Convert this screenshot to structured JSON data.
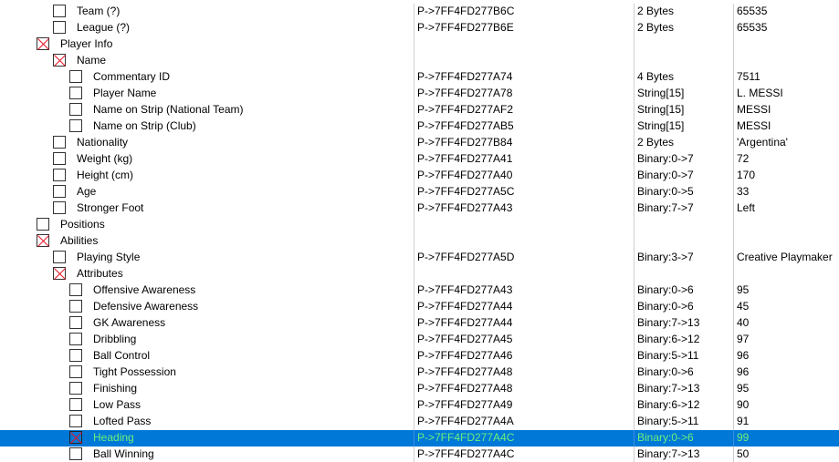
{
  "rows": [
    {
      "indent": 1,
      "checked": false,
      "desc": "Team (?)",
      "address": "P->7FF4FD277B6C",
      "type": "2 Bytes",
      "value": "65535"
    },
    {
      "indent": 1,
      "checked": false,
      "desc": "League (?)",
      "address": "P->7FF4FD277B6E",
      "type": "2 Bytes",
      "value": "65535"
    },
    {
      "indent": 0,
      "checked": true,
      "desc": "Player Info",
      "address": "",
      "type": "",
      "value": ""
    },
    {
      "indent": 1,
      "checked": true,
      "desc": "Name",
      "address": "",
      "type": "",
      "value": ""
    },
    {
      "indent": 2,
      "checked": false,
      "desc": "Commentary ID",
      "address": "P->7FF4FD277A74",
      "type": "4 Bytes",
      "value": "7511"
    },
    {
      "indent": 2,
      "checked": false,
      "desc": "Player Name",
      "address": "P->7FF4FD277A78",
      "type": "String[15]",
      "value": "L. MESSI"
    },
    {
      "indent": 2,
      "checked": false,
      "desc": "Name on Strip (National Team)",
      "address": "P->7FF4FD277AF2",
      "type": "String[15]",
      "value": "MESSI"
    },
    {
      "indent": 2,
      "checked": false,
      "desc": "Name on Strip (Club)",
      "address": "P->7FF4FD277AB5",
      "type": "String[15]",
      "value": "MESSI"
    },
    {
      "indent": 1,
      "checked": false,
      "desc": "Nationality",
      "address": "P->7FF4FD277B84",
      "type": "2 Bytes",
      "value": " 'Argentina'"
    },
    {
      "indent": 1,
      "checked": false,
      "desc": "Weight (kg)",
      "address": "P->7FF4FD277A41",
      "type": "Binary:0->7",
      "value": "72"
    },
    {
      "indent": 1,
      "checked": false,
      "desc": "Height (cm)",
      "address": "P->7FF4FD277A40",
      "type": "Binary:0->7",
      "value": "170"
    },
    {
      "indent": 1,
      "checked": false,
      "desc": "Age",
      "address": "P->7FF4FD277A5C",
      "type": "Binary:0->5",
      "value": "33"
    },
    {
      "indent": 1,
      "checked": false,
      "desc": "Stronger Foot",
      "address": "P->7FF4FD277A43",
      "type": "Binary:7->7",
      "value": "Left"
    },
    {
      "indent": 0,
      "checked": false,
      "desc": "Positions",
      "address": "",
      "type": "",
      "value": ""
    },
    {
      "indent": 0,
      "checked": true,
      "desc": "Abilities",
      "address": "",
      "type": "",
      "value": ""
    },
    {
      "indent": 1,
      "checked": false,
      "desc": "Playing Style",
      "address": "P->7FF4FD277A5D",
      "type": "Binary:3->7",
      "value": "Creative Playmaker"
    },
    {
      "indent": 1,
      "checked": true,
      "desc": "Attributes",
      "address": "",
      "type": "",
      "value": ""
    },
    {
      "indent": 2,
      "checked": false,
      "desc": "Offensive Awareness",
      "address": "P->7FF4FD277A43",
      "type": "Binary:0->6",
      "value": "95"
    },
    {
      "indent": 2,
      "checked": false,
      "desc": "Defensive Awareness",
      "address": "P->7FF4FD277A44",
      "type": "Binary:0->6",
      "value": "45"
    },
    {
      "indent": 2,
      "checked": false,
      "desc": "GK Awareness",
      "address": "P->7FF4FD277A44",
      "type": "Binary:7->13",
      "value": "40"
    },
    {
      "indent": 2,
      "checked": false,
      "desc": "Dribbling",
      "address": "P->7FF4FD277A45",
      "type": "Binary:6->12",
      "value": "97"
    },
    {
      "indent": 2,
      "checked": false,
      "desc": "Ball Control",
      "address": "P->7FF4FD277A46",
      "type": "Binary:5->11",
      "value": "96"
    },
    {
      "indent": 2,
      "checked": false,
      "desc": "Tight Possession",
      "address": "P->7FF4FD277A48",
      "type": "Binary:0->6",
      "value": "96"
    },
    {
      "indent": 2,
      "checked": false,
      "desc": "Finishing",
      "address": "P->7FF4FD277A48",
      "type": "Binary:7->13",
      "value": "95"
    },
    {
      "indent": 2,
      "checked": false,
      "desc": "Low Pass",
      "address": "P->7FF4FD277A49",
      "type": "Binary:6->12",
      "value": "90"
    },
    {
      "indent": 2,
      "checked": false,
      "desc": "Lofted Pass",
      "address": "P->7FF4FD277A4A",
      "type": "Binary:5->11",
      "value": "91"
    },
    {
      "indent": 2,
      "checked": true,
      "selected": true,
      "desc": "Heading",
      "address": "P->7FF4FD277A4C",
      "type": "Binary:0->6",
      "value": "99"
    },
    {
      "indent": 2,
      "checked": false,
      "desc": "Ball Winning",
      "address": "P->7FF4FD277A4C",
      "type": "Binary:7->13",
      "value": "50"
    }
  ],
  "colors": {
    "selection": "#0078d7",
    "selected_text": "#6cf07a",
    "check_mark": "#e81123",
    "grid_line": "#cfcfcf"
  },
  "icons": {
    "checkbox_checked": "red-x-checkbox-icon",
    "checkbox_unchecked": "empty-checkbox-icon"
  }
}
